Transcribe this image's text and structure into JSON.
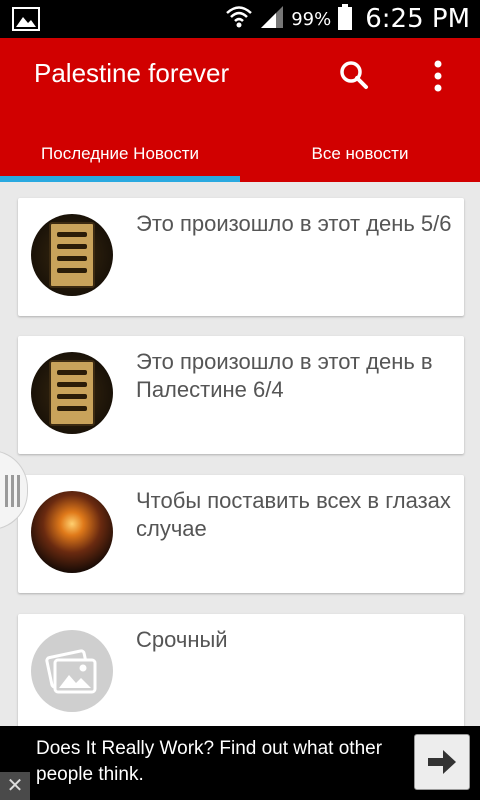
{
  "status_bar": {
    "battery_percent": "99%",
    "time": "6:25 PM"
  },
  "app_bar": {
    "title": "Palestine forever",
    "color": "#d10000",
    "search_icon": "search-icon",
    "menu_icon": "more-vert-icon"
  },
  "tabs": [
    {
      "label": "Последние Новости",
      "selected": true
    },
    {
      "label": "Все новости",
      "selected": false
    }
  ],
  "accent_color": "#2aa9e0",
  "articles": [
    {
      "title": "Это произошло в этот день 5/6",
      "thumbnail": "book-image"
    },
    {
      "title": "Это произошло в этот день в Палестине 6/4",
      "thumbnail": "book-image"
    },
    {
      "title": "Чтобы поставить всех в глазах случае",
      "thumbnail": "sunset-image"
    },
    {
      "title": "Срочный",
      "thumbnail": "image-placeholder-icon"
    }
  ],
  "ad": {
    "text": "Does It Really Work? Find out what other people think.",
    "button_icon": "arrow-right-icon",
    "close_label": "✕"
  }
}
